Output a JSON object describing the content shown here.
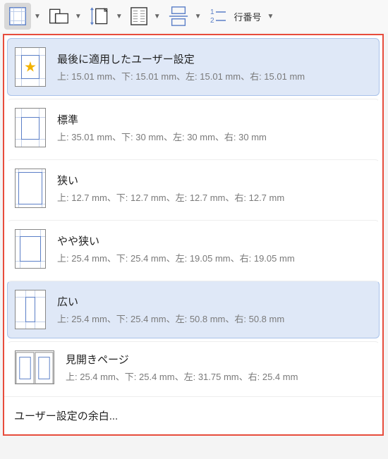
{
  "toolbar": {
    "line_numbers_label": "行番号"
  },
  "menu": {
    "items": [
      {
        "title": "最後に適用したユーザー設定",
        "detail": "上: 15.01 mm、下: 15.01 mm、左: 15.01 mm、右: 15.01 mm",
        "selected": true,
        "thumb": "star"
      },
      {
        "title": "標準",
        "detail": "上: 35.01 mm、下: 30 mm、左: 30 mm、右: 30 mm",
        "selected": false,
        "thumb": "normal"
      },
      {
        "title": "狭い",
        "detail": "上: 12.7 mm、下: 12.7 mm、左: 12.7 mm、右: 12.7 mm",
        "selected": false,
        "thumb": "narrow"
      },
      {
        "title": "やや狭い",
        "detail": "上: 25.4 mm、下: 25.4 mm、左: 19.05 mm、右: 19.05 mm",
        "selected": false,
        "thumb": "moderate"
      },
      {
        "title": "広い",
        "detail": "上: 25.4 mm、下: 25.4 mm、左: 50.8 mm、右: 50.8 mm",
        "selected": true,
        "thumb": "wide"
      },
      {
        "title": "見開きページ",
        "detail": "上: 25.4 mm、下: 25.4 mm、左: 31.75 mm、右: 25.4 mm",
        "selected": false,
        "thumb": "mirrored"
      }
    ],
    "custom_label": "ユーザー設定の余白..."
  }
}
